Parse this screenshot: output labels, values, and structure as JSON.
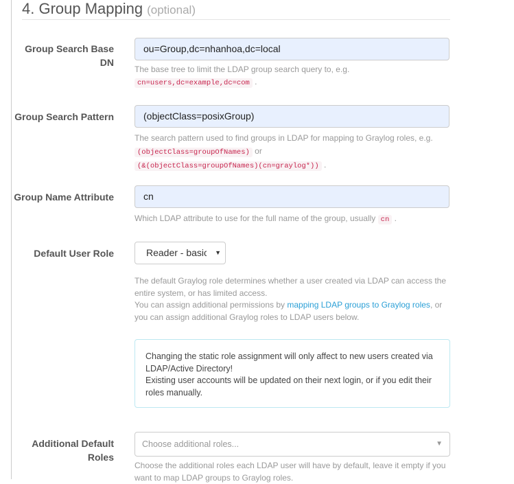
{
  "section": {
    "title": "4. Group Mapping",
    "optional": "(optional)"
  },
  "fields": {
    "base_dn": {
      "label": "Group Search Base DN",
      "value": "ou=Group,dc=nhanhoa,dc=local",
      "help": "The base tree to limit the LDAP group search query to, e.g.",
      "code": "cn=users,dc=example,dc=com",
      "after": "."
    },
    "pattern": {
      "label": "Group Search Pattern",
      "value": "(objectClass=posixGroup)",
      "help": "The search pattern used to find groups in LDAP for mapping to Graylog roles, e.g.",
      "code1": "(objectClass=groupOfNames)",
      "or": "or",
      "code2": "(&(objectClass=groupOfNames)(cn=graylog*))",
      "after": "."
    },
    "name_attr": {
      "label": "Group Name Attribute",
      "value": "cn",
      "help": "Which LDAP attribute to use for the full name of the group, usually",
      "code": "cn",
      "after": "."
    },
    "default_role": {
      "label": "Default User Role",
      "value": "Reader - basic access",
      "help1": "The default Graylog role determines whether a user created via LDAP can access the entire system, or has limited access.",
      "help2": "You can assign additional permissions by",
      "link": "mapping LDAP groups to Graylog roles",
      "help3": ", or you can assign additional Graylog roles to LDAP users below."
    },
    "alert": {
      "line1": "Changing the static role assignment will only affect to new users created via LDAP/Active Directory!",
      "line2": "Existing user accounts will be updated on their next login, or if you edit their roles manually."
    },
    "additional": {
      "label": "Additional Default Roles",
      "placeholder": "Choose additional roles...",
      "help": "Choose the additional roles each LDAP user will have by default, leave it empty if you want to map LDAP groups to Graylog roles."
    }
  }
}
